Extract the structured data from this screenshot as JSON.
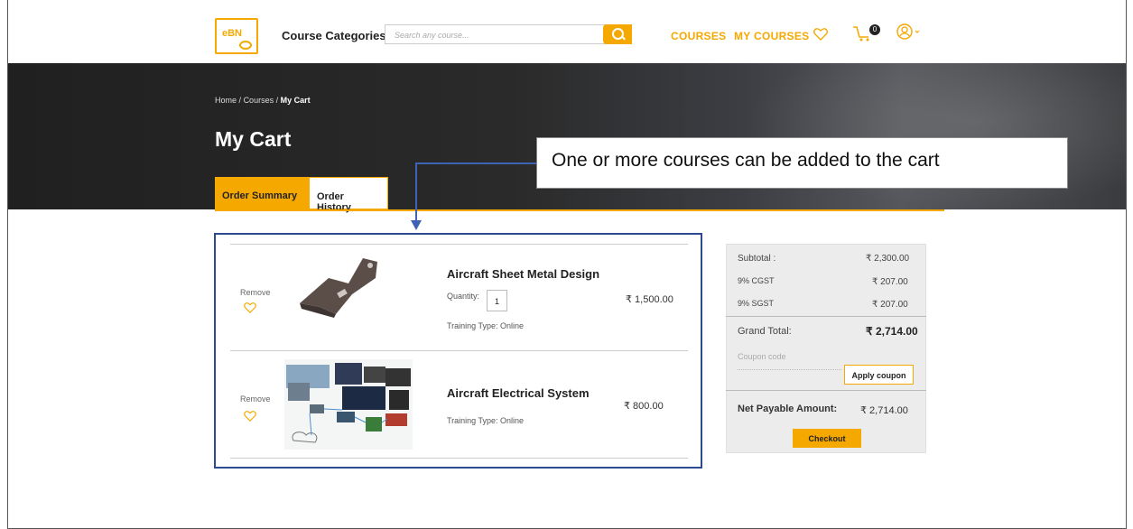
{
  "header": {
    "logo_text": "eBN",
    "course_categories": "Course Categories",
    "search_placeholder": "Search any course...",
    "nav_courses": "COURSES",
    "nav_my_courses": "MY COURSES",
    "cart_count": "0"
  },
  "hero": {
    "breadcrumb_home": "Home",
    "breadcrumb_sep": "/",
    "breadcrumb_courses": "Courses",
    "breadcrumb_current": "My Cart",
    "title": "My Cart",
    "tab_order_summary": "Order Summary",
    "tab_order_history": "Order History"
  },
  "callout": "One or more courses can be added to the cart",
  "cart": {
    "items": [
      {
        "remove_label": "Remove",
        "name": "Aircraft Sheet Metal Design",
        "quantity_label": "Quantity:",
        "quantity": "1",
        "training_type": "Training Type: Online",
        "price": "₹ 1,500.00"
      },
      {
        "remove_label": "Remove",
        "name": "Aircraft Electrical System",
        "training_type": "Training Type: Online",
        "price": "₹ 800.00"
      }
    ]
  },
  "summary": {
    "subtotal_label": "Subtotal :",
    "subtotal_value": "₹ 2,300.00",
    "cgst_label": "9% CGST",
    "cgst_value": "₹ 207.00",
    "sgst_label": "9% SGST",
    "sgst_value": "₹ 207.00",
    "grand_total_label": "Grand Total:",
    "grand_total_value": "₹ 2,714.00",
    "coupon_placeholder": "Coupon code",
    "apply_coupon": "Apply coupon",
    "net_payable_label": "Net Payable Amount:",
    "net_payable_value": "₹ 2,714.00",
    "checkout": "Checkout"
  },
  "colors": {
    "accent": "#f5a800",
    "annotation": "#3f63b4"
  }
}
